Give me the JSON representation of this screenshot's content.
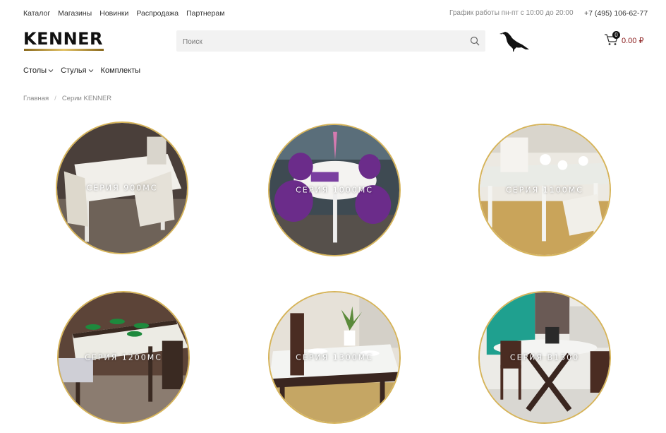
{
  "topnav": {
    "links": [
      "Каталог",
      "Магазины",
      "Новинки",
      "Распродажа",
      "Партнерам"
    ],
    "schedule": "График работы пн-пт с 10:00 до 20:00",
    "phone": "+7 (495) 106-62-77"
  },
  "header": {
    "logo": "KENNER",
    "search_placeholder": "Поиск",
    "cart_count": "0",
    "cart_total": "0.00 ₽"
  },
  "catnav": {
    "items": [
      "Столы",
      "Стулья",
      "Комплекты"
    ]
  },
  "breadcrumb": {
    "home": "Главная",
    "separator": "/",
    "current": "Серии KENNER"
  },
  "series": [
    {
      "label": "СЕРИЯ 900МС"
    },
    {
      "label": "СЕРИЯ 1000МС"
    },
    {
      "label": "СЕРИЯ 1100МС"
    },
    {
      "label": "СЕРИЯ 1200МС"
    },
    {
      "label": "СЕРИЯ 1300МС"
    },
    {
      "label": "СЕРИЯ B1300"
    }
  ],
  "colors": {
    "accent_gold": "#d6b45a",
    "price": "#8a1c1c"
  }
}
